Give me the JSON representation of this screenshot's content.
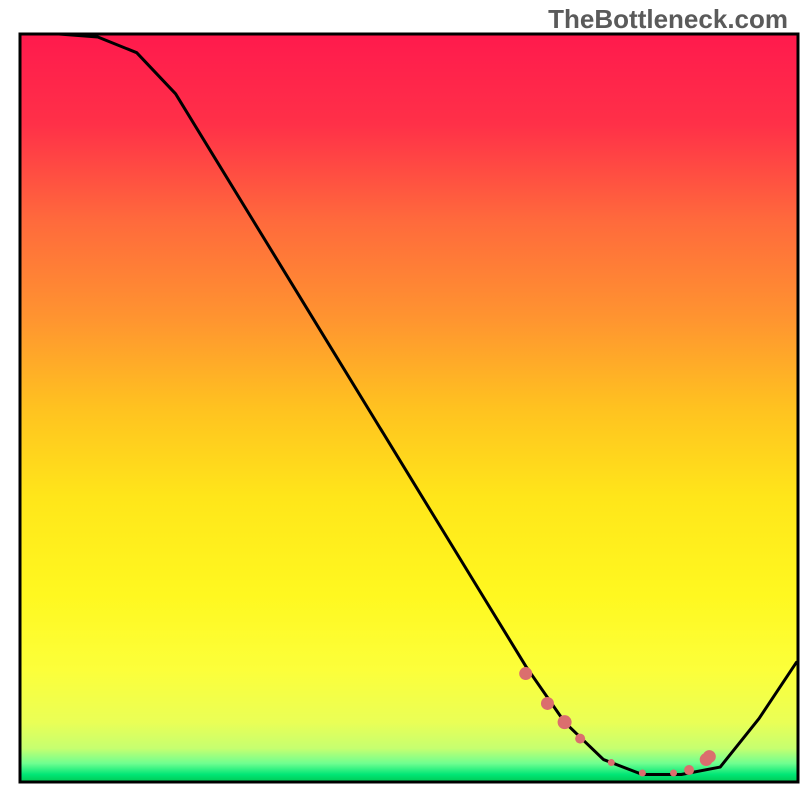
{
  "watermark": "TheBottleneck.com",
  "chart_data": {
    "type": "line",
    "title": "",
    "xlabel": "",
    "ylabel": "",
    "xlim": [
      0,
      100
    ],
    "ylim": [
      0,
      100
    ],
    "background_gradient_stops": [
      {
        "offset": 0.0,
        "color": "#ff1a4d"
      },
      {
        "offset": 0.12,
        "color": "#ff3048"
      },
      {
        "offset": 0.25,
        "color": "#ff6a3c"
      },
      {
        "offset": 0.38,
        "color": "#ff9430"
      },
      {
        "offset": 0.5,
        "color": "#ffc220"
      },
      {
        "offset": 0.62,
        "color": "#ffe61a"
      },
      {
        "offset": 0.75,
        "color": "#fff820"
      },
      {
        "offset": 0.85,
        "color": "#fcff3a"
      },
      {
        "offset": 0.92,
        "color": "#eaff56"
      },
      {
        "offset": 0.955,
        "color": "#c6ff70"
      },
      {
        "offset": 0.975,
        "color": "#70ff90"
      },
      {
        "offset": 0.99,
        "color": "#00e676"
      },
      {
        "offset": 1.0,
        "color": "#00c853"
      }
    ],
    "curve": {
      "x": [
        2,
        5,
        10,
        15,
        20,
        25,
        30,
        35,
        40,
        45,
        50,
        55,
        60,
        65,
        70,
        75,
        80,
        85,
        90,
        95,
        99.8
      ],
      "y": [
        100,
        100,
        99.6,
        97.5,
        92,
        83.5,
        75,
        66.5,
        58,
        49.5,
        41,
        32.5,
        24,
        15.5,
        8,
        3,
        1,
        1,
        2,
        8.5,
        16
      ]
    },
    "markers": {
      "x": [
        65.0,
        67.8,
        70.0,
        72.0,
        76.0,
        80.0,
        84.0,
        86.0,
        88.2,
        88.6
      ],
      "y": [
        14.5,
        10.5,
        8.0,
        5.8,
        2.6,
        1.2,
        1.2,
        1.6,
        3.0,
        3.4
      ],
      "color": "#db6e6e",
      "sizes": [
        6.5,
        6.5,
        7.0,
        5.0,
        3.5,
        3.5,
        3.5,
        5.0,
        6.5,
        6.5
      ]
    },
    "frame": {
      "inset_left": 20,
      "inset_right": 2,
      "inset_top": 34,
      "inset_bottom": 18,
      "stroke": "#000000",
      "stroke_width": 3
    }
  }
}
